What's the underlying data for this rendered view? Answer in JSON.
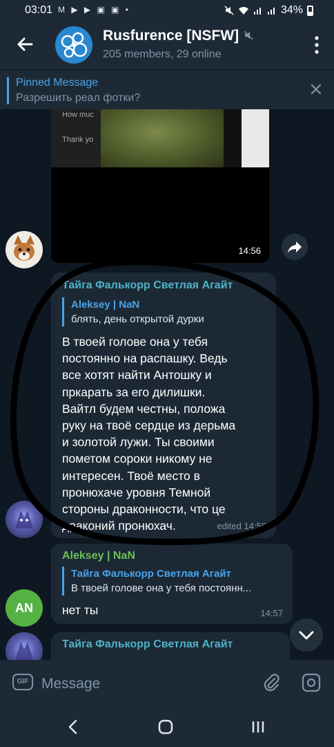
{
  "status_bar": {
    "time": "03:01",
    "notification_icons": "M ▶ ▶ ▣ ▣ •",
    "battery": "34%"
  },
  "header": {
    "title": "Rusfurence [NSFW]",
    "subtitle": "205 members, 29 online"
  },
  "pinned": {
    "label": "Pinned Message",
    "text": "Разрешить реал фотки?"
  },
  "messages": {
    "media": {
      "caption_line1": "How muc",
      "caption_line2": "Thank yo",
      "time": "14:56"
    },
    "taiga_1": {
      "sender": "Тайга Фалькорр Светлая Агайт",
      "reply_name": "Aleksey | NaN",
      "reply_text": "блять, день открытой дурки",
      "body_lines": [
        "В твоей голове она у тебя",
        "постоянно на распашку. Ведь",
        "все хотят найти Антошку и",
        "пркарать за его дилишки.",
        "Вайтл будем честны, положа",
        "руку на твоё сердце из дерьма",
        "и золотой лужи. Ты своими",
        "пометом сороки никому не",
        "интересен. Твоё место в",
        "пронюхаче уровня Темной",
        "стороны драконности, что це",
        "драконий пронюхач."
      ],
      "meta": "edited 14:56"
    },
    "aleksey": {
      "sender": "Aleksey | NaN",
      "reply_name": "Тайга Фалькорр Светлая Агайт",
      "reply_text": "В твоей голове она у тебя постоянн...",
      "body": "нет ты",
      "meta": "14:57",
      "avatar_initials": "AN"
    },
    "taiga_2": {
      "sender": "Тайга Фалькорр Светлая Агайт"
    }
  },
  "composer": {
    "gif_label": "GIF",
    "placeholder": "Message"
  },
  "colors": {
    "background": "#0e1822",
    "header": "#1d2a36",
    "bubble": "#1c2935",
    "accent_blue": "#4aa3e8",
    "sender_taiga": "#4fb3c8",
    "sender_aleksey": "#6cc05a",
    "muted_text": "#7f94a6"
  },
  "icons": [
    "back-arrow-icon",
    "mute-icon",
    "more-vert-icon",
    "close-icon",
    "share-icon",
    "chevron-down-icon",
    "gif-icon",
    "paperclip-icon",
    "camera-icon",
    "nav-back-icon",
    "nav-home-icon",
    "nav-recent-icon"
  ]
}
